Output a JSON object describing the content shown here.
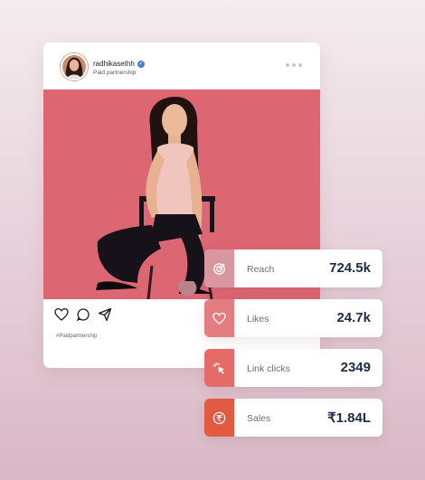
{
  "post": {
    "username": "radhikasethh",
    "subtitle": "Paid partnership",
    "hashtag": "#Paidpartnership",
    "icons": [
      "verified-badge-icon",
      "more-options-icon",
      "heart-icon",
      "comment-icon",
      "share-icon"
    ]
  },
  "metrics": [
    {
      "label": "Reach",
      "value": "724.5k",
      "icon": "target-icon",
      "color": "#d9979f"
    },
    {
      "label": "Likes",
      "value": "24.7k",
      "icon": "heart-icon",
      "color": "#e37d82"
    },
    {
      "label": "Link clicks",
      "value": "2349",
      "icon": "click-icon",
      "color": "#e56b68"
    },
    {
      "label": "Sales",
      "value": "₹1.84L",
      "icon": "rupee-icon",
      "color": "#e25a3f"
    }
  ],
  "colors": {
    "background_top": "#f4ecef",
    "background_bottom": "#d9b8c5",
    "photo_background": "#dd6673",
    "value_text": "#1d2a4a",
    "verified": "#3b82d6"
  }
}
